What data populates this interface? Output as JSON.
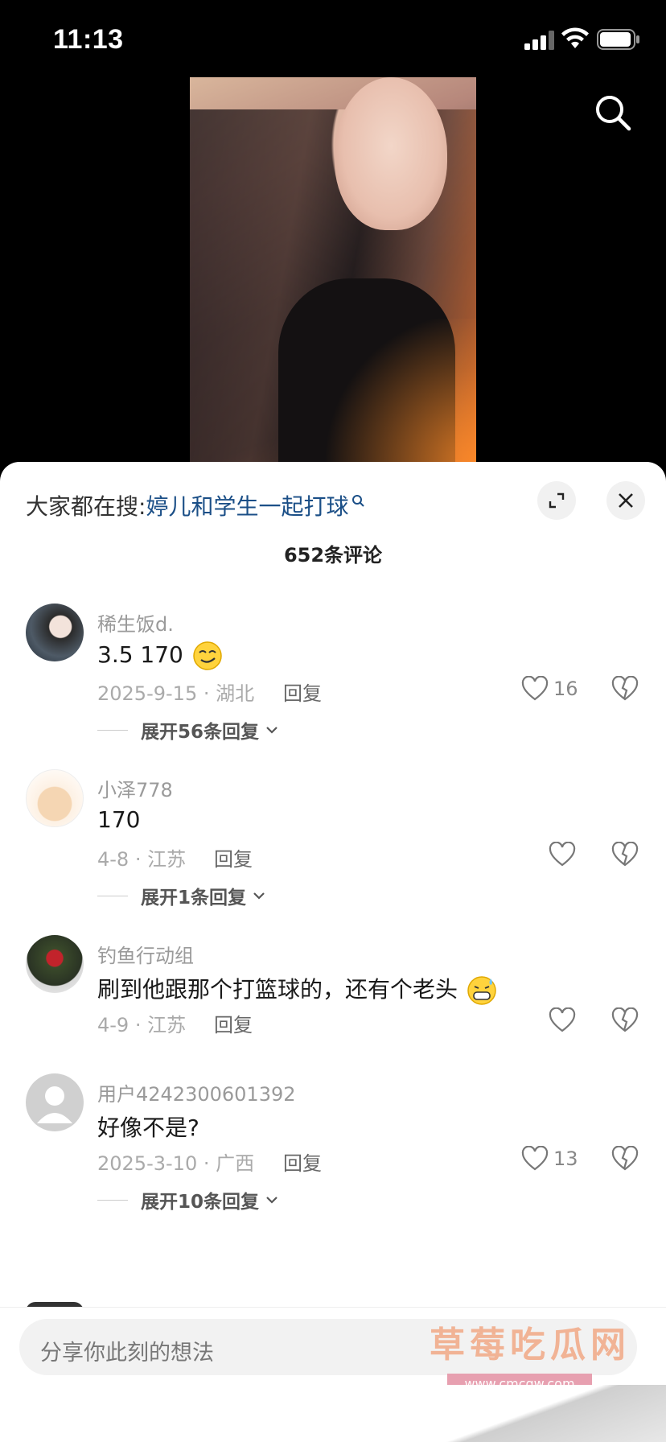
{
  "status_bar": {
    "time": "11:13"
  },
  "search_bar": {
    "prefix": "大家都在搜:",
    "keyword": "婷儿和学生一起打球"
  },
  "comments_header": {
    "count_label": "652条评论"
  },
  "comments": [
    {
      "user": "稀生饭d.",
      "text": "3.5 170",
      "emoji": "smirk",
      "date_loc": "2025-9-15 · 湖北",
      "reply": "回复",
      "likes": "16",
      "expand": "展开56条回复"
    },
    {
      "user": "小泽778",
      "text": "170",
      "date_loc": "4-8 · 江苏",
      "reply": "回复",
      "likes": "",
      "expand": "展开1条回复"
    },
    {
      "user": "钓鱼行动组",
      "text": "刷到他跟那个打篮球的，还有个老头",
      "emoji": "grin-sweat",
      "date_loc": "4-9 · 江苏",
      "reply": "回复",
      "likes": ""
    },
    {
      "user": "用户4242300601392",
      "text": "好像不是?",
      "date_loc": "2025-3-10 · 广西",
      "reply": "回复",
      "likes": "13",
      "expand": "展开10条回复"
    }
  ],
  "composer": {
    "placeholder": "分享你此刻的想法"
  },
  "watermark": {
    "title": "草莓吃瓜网",
    "url": "www.cmcgw.com"
  },
  "colors": {
    "keyword": "#1b4f87",
    "sheet_bg": "#ffffff",
    "screen_bg": "#000000"
  }
}
